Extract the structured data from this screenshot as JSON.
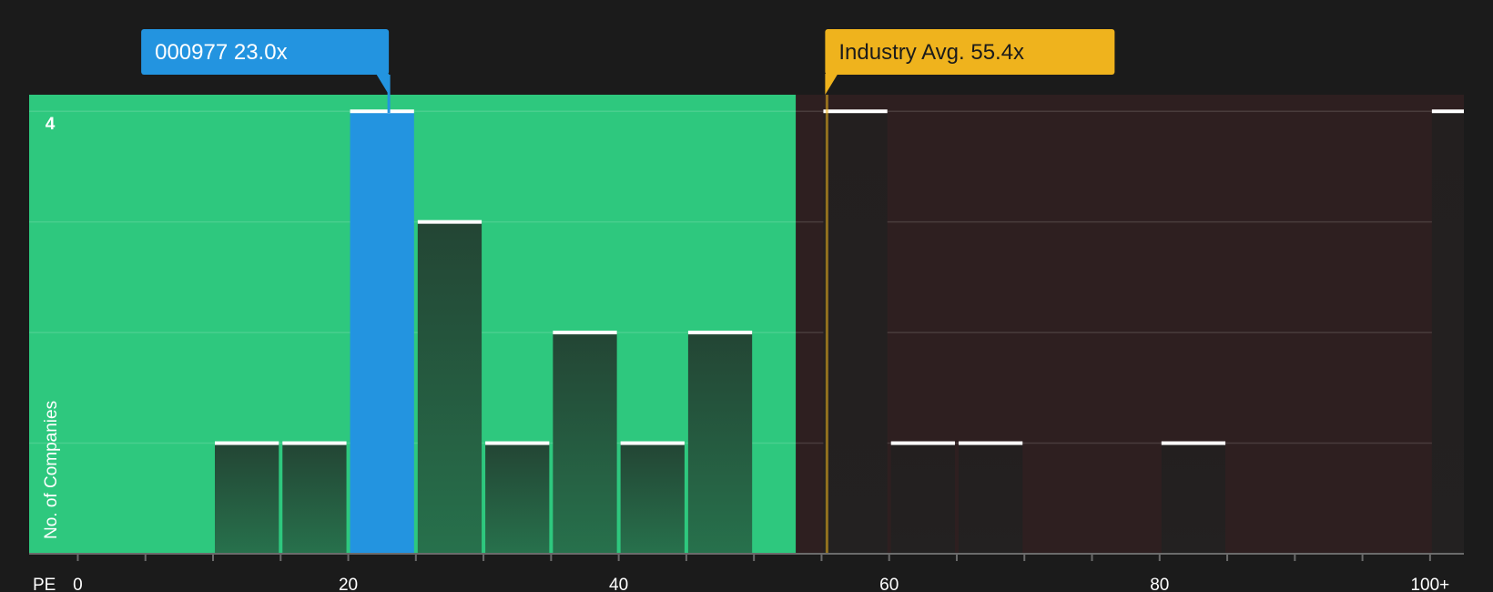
{
  "chart_data": {
    "type": "bar",
    "xlabel": "PE",
    "ylabel": "No. of Companies",
    "x_ticks": [
      {
        "value": 0,
        "label": "0"
      },
      {
        "value": 20,
        "label": "20"
      },
      {
        "value": 40,
        "label": "40"
      },
      {
        "value": 60,
        "label": "60"
      },
      {
        "value": 80,
        "label": "80"
      },
      {
        "value": 100,
        "label": "100+"
      }
    ],
    "y_ticks": [
      {
        "value": 4,
        "label": "4"
      }
    ],
    "xlim": [
      -3.6,
      102.5
    ],
    "ylim": [
      0,
      4.15
    ],
    "bin_width": 5,
    "bars": [
      {
        "start": 10,
        "end": 15,
        "count": 1
      },
      {
        "start": 15,
        "end": 20,
        "count": 1
      },
      {
        "start": 20,
        "end": 25,
        "count": 4,
        "highlight": true
      },
      {
        "start": 25,
        "end": 30,
        "count": 3
      },
      {
        "start": 30,
        "end": 35,
        "count": 1
      },
      {
        "start": 35,
        "end": 40,
        "count": 2
      },
      {
        "start": 40,
        "end": 45,
        "count": 1
      },
      {
        "start": 45,
        "end": 50,
        "count": 2
      },
      {
        "start": 55,
        "end": 60,
        "count": 4
      },
      {
        "start": 60,
        "end": 65,
        "count": 1
      },
      {
        "start": 65,
        "end": 70,
        "count": 1
      },
      {
        "start": 80,
        "end": 85,
        "count": 1
      },
      {
        "start": 100,
        "end": 105,
        "count": 4
      }
    ],
    "regions": [
      {
        "from": -3.6,
        "to": 53.1,
        "kind": "below-average",
        "color": "#2ec87e"
      },
      {
        "from": 53.1,
        "to": 102.5,
        "kind": "above-average",
        "color": "#2e1f20"
      }
    ],
    "annotations": [
      {
        "kind": "company",
        "label": "000977 23.0x",
        "value": 23.0,
        "color": "#2394e0"
      },
      {
        "kind": "industry-average",
        "label": "Industry Avg. 55.4x",
        "value": 55.4,
        "color": "#efb31d"
      }
    ],
    "grid": true
  }
}
